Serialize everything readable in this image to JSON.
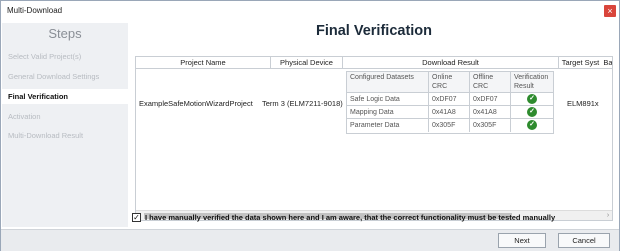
{
  "window": {
    "title": "Multi-Download",
    "close_glyph": "×"
  },
  "sidebar": {
    "title": "Steps",
    "items": [
      {
        "label": "Select Valid Project(s)",
        "active": false
      },
      {
        "label": "General Download Settings",
        "active": false
      },
      {
        "label": "Final Verification",
        "active": true
      },
      {
        "label": "Activation",
        "active": false
      },
      {
        "label": "Multi-Download Result",
        "active": false
      }
    ]
  },
  "main": {
    "heading": "Final Verification",
    "columns": [
      "Project Name",
      "Physical Device",
      "Download Result",
      "Target Syst",
      "Ba"
    ],
    "row": {
      "project_name": "ExampleSafeMotionWizardProject",
      "physical_device": "Term 3 (ELM7211-9018)",
      "target_system": "ELM891x"
    },
    "inner_table": {
      "headers": [
        "Configured Datasets",
        "Online CRC",
        "Offline CRC",
        "Verification Result"
      ],
      "rows": [
        {
          "dataset": "Safe Logic Data",
          "online": "0xDF07",
          "offline": "0xDF07",
          "result": "ok"
        },
        {
          "dataset": "Mapping Data",
          "online": "0x41A8",
          "offline": "0x41A8",
          "result": "ok"
        },
        {
          "dataset": "Parameter Data",
          "online": "0x305F",
          "offline": "0x305F",
          "result": "ok"
        }
      ]
    },
    "scroll_left": "‹",
    "scroll_right": "›"
  },
  "confirm": {
    "checked": true,
    "check_glyph": "✓",
    "label": "I have manually verified the data shown here and I am aware, that the correct functionality must be tested manually"
  },
  "footer": {
    "next_label": "Next",
    "cancel_label": "Cancel"
  },
  "colors": {
    "accent_green": "#2e8b2e",
    "close_red": "#d9453b",
    "sidebar_bg": "#eef0f3"
  }
}
